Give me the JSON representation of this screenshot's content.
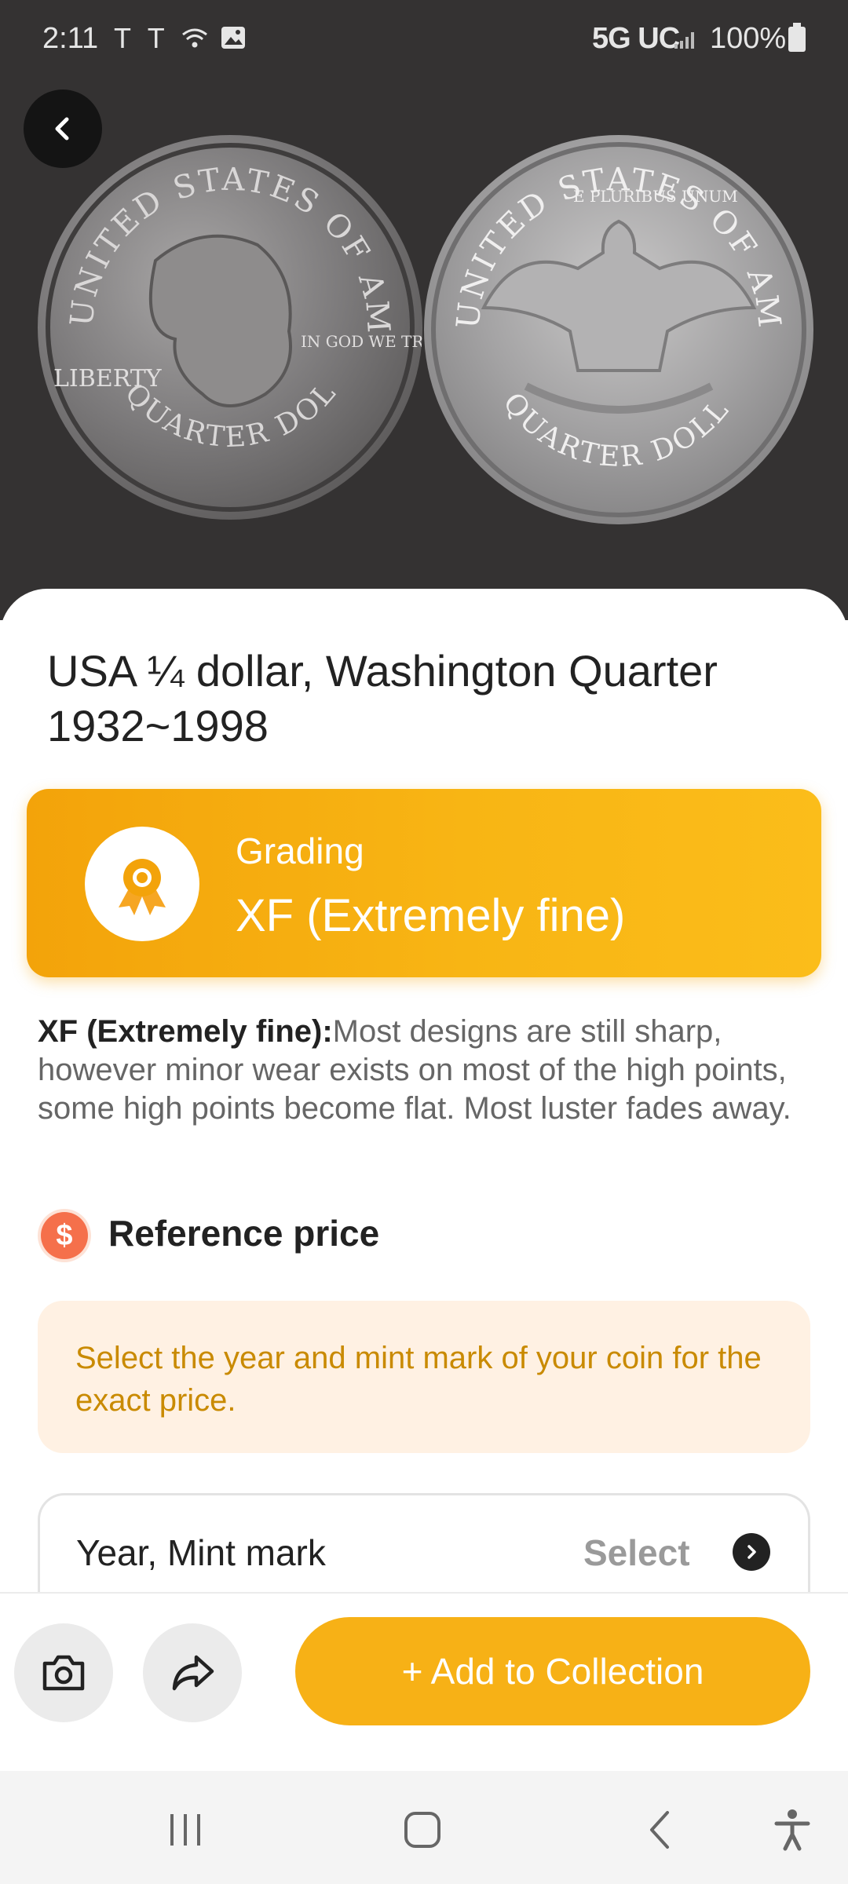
{
  "status_bar": {
    "time": "2:11",
    "network": "5G UC",
    "battery": "100%"
  },
  "coin": {
    "title": "USA ¼ dollar, Washington Quarter 1932~1998",
    "front_legend": "UNITED STATES OF AMERICA",
    "front_liberty": "LIBERTY",
    "front_motto": "IN GOD WE TRUST",
    "front_bottom": "QUARTER DOLLAR",
    "back_legend": "UNITED STATES OF AMERICA",
    "back_motto": "E PLURIBUS UNUM",
    "back_bottom": "QUARTER DOLLAR"
  },
  "grading": {
    "label": "Grading",
    "value": "XF (Extremely fine)",
    "description_term": "XF (Extremely fine):",
    "description_text": "Most designs are still sharp, however minor wear exists on most of the high points, some high points become flat. Most luster fades away."
  },
  "reference_price": {
    "icon_symbol": "$",
    "title": "Reference price",
    "hint": "Select the year and mint mark of your coin for the exact price.",
    "select_label": "Year, Mint mark",
    "select_action": "Select"
  },
  "actions": {
    "add_to_collection": "+ Add to Collection"
  },
  "colors": {
    "accent": "#f7b116",
    "grade_card_start": "#f3a30a",
    "grade_card_end": "#fbbd1a",
    "hint_bg": "#fff1e3",
    "hint_text": "#c98a00",
    "price_icon": "#f5704b"
  },
  "icons": {
    "back": "chevron-left-icon",
    "camera": "camera-icon",
    "share": "share-icon",
    "grade": "award-ribbon-icon",
    "select_chevron": "chevron-right-icon",
    "nav_recents": "recent-apps-icon",
    "nav_home": "home-icon",
    "nav_back": "back-icon",
    "nav_accessibility": "accessibility-icon"
  }
}
